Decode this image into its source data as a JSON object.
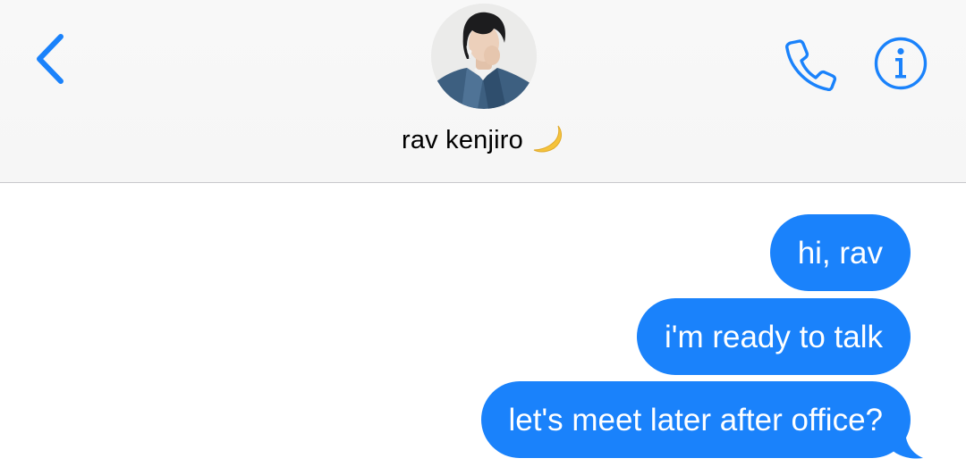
{
  "header": {
    "contact_name": "rav kenjiro",
    "back_icon": "chevron-left-icon",
    "call_icon": "phone-icon",
    "info_icon": "info-circle-icon",
    "status_emoji_icon": "crescent-moon-icon"
  },
  "messages": [
    {
      "direction": "outgoing",
      "text": "hi, rav"
    },
    {
      "direction": "outgoing",
      "text": "i'm ready to talk"
    },
    {
      "direction": "outgoing",
      "text": "let's meet later after office?"
    }
  ],
  "colors": {
    "accent": "#1a82fb",
    "bubble_text": "#ffffff",
    "header_bg": "#f7f7f7",
    "moon": "#f5c33b"
  }
}
